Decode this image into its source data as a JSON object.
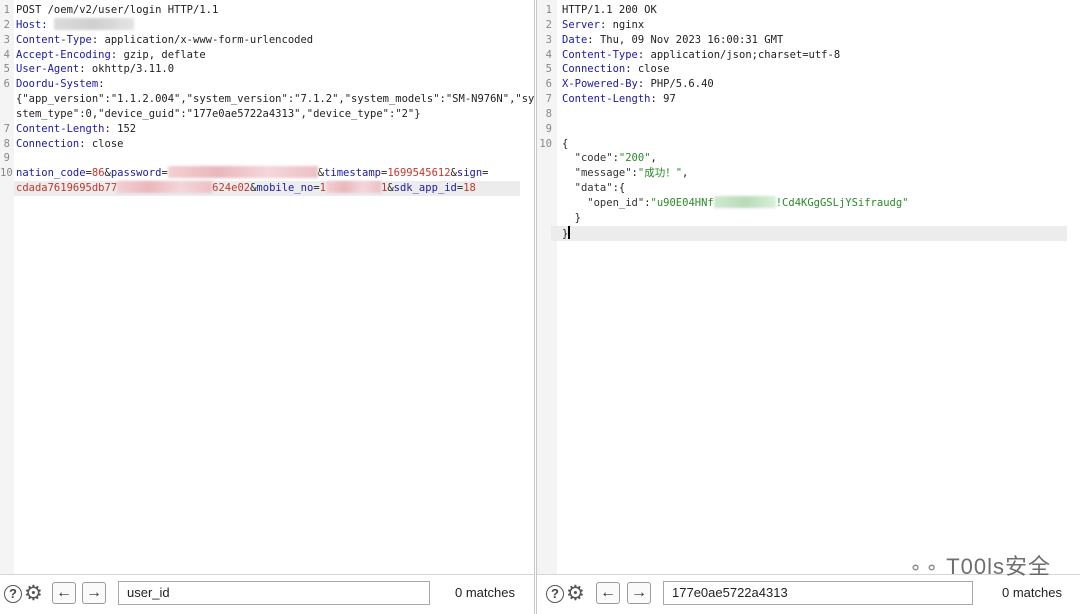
{
  "request": {
    "lines": [
      {
        "num": "1",
        "parts": [
          {
            "t": "POST /oem/v2/user/login HTTP/1.1",
            "c": ""
          }
        ]
      },
      {
        "num": "2",
        "parts": [
          {
            "t": "Host: ",
            "c": "hk"
          },
          {
            "blur": 80,
            "c": "gray"
          }
        ]
      },
      {
        "num": "3",
        "parts": [
          {
            "t": "Content-Type",
            "c": "hk"
          },
          {
            "t": ": application/x-www-form-urlencoded",
            "c": ""
          }
        ]
      },
      {
        "num": "4",
        "parts": [
          {
            "t": "Accept-Encoding",
            "c": "hk"
          },
          {
            "t": ": gzip, deflate",
            "c": ""
          }
        ]
      },
      {
        "num": "5",
        "parts": [
          {
            "t": "User-Agent",
            "c": "hk"
          },
          {
            "t": ": okhttp/3.11.0",
            "c": ""
          }
        ]
      },
      {
        "num": "6",
        "parts": [
          {
            "t": "Doordu-System",
            "c": "hk"
          },
          {
            "t": ":",
            "c": ""
          }
        ]
      },
      {
        "num": "",
        "parts": [
          {
            "t": "{\"app_version\":\"1.1.2.004\",\"system_version\":\"7.1.2\",\"system_models\":\"SM-N976N\",\"sy",
            "c": ""
          }
        ]
      },
      {
        "num": "",
        "parts": [
          {
            "t": "stem_type\":0,\"device_guid\":\"177e0ae5722a4313\",\"device_type\":\"2\"}",
            "c": ""
          }
        ]
      },
      {
        "num": "7",
        "parts": [
          {
            "t": "Content-Length",
            "c": "hk"
          },
          {
            "t": ": 152",
            "c": ""
          }
        ]
      },
      {
        "num": "8",
        "parts": [
          {
            "t": "Connection",
            "c": "hk"
          },
          {
            "t": ": close",
            "c": ""
          }
        ]
      },
      {
        "num": "9",
        "parts": [
          {
            "t": "",
            "c": ""
          }
        ]
      },
      {
        "num": "10",
        "parts": [
          {
            "t": "nation_code",
            "c": "pk"
          },
          {
            "t": "=",
            "c": "amp"
          },
          {
            "t": "86",
            "c": "pv"
          },
          {
            "t": "&",
            "c": "amp"
          },
          {
            "t": "password",
            "c": "pk"
          },
          {
            "t": "=",
            "c": "amp"
          },
          {
            "blur": 150,
            "c": ""
          },
          {
            "t": "&",
            "c": "amp"
          },
          {
            "t": "timestamp",
            "c": "pk"
          },
          {
            "t": "=",
            "c": "amp"
          },
          {
            "t": "1699545612",
            "c": "pv"
          },
          {
            "t": "&",
            "c": "amp"
          },
          {
            "t": "sign",
            "c": "pk"
          },
          {
            "t": "=",
            "c": "amp"
          }
        ]
      },
      {
        "num": "",
        "hl": true,
        "parts": [
          {
            "t": "cdada7619695db77",
            "c": "pv"
          },
          {
            "blur": 95,
            "c": ""
          },
          {
            "t": "624e02",
            "c": "pv"
          },
          {
            "t": "&",
            "c": "amp"
          },
          {
            "t": "mobile_no",
            "c": "pk"
          },
          {
            "t": "=",
            "c": "amp"
          },
          {
            "t": "1",
            "c": "pv"
          },
          {
            "blur": 55,
            "c": ""
          },
          {
            "t": "1",
            "c": "pv"
          },
          {
            "t": "&",
            "c": "amp"
          },
          {
            "t": "sdk_app_id",
            "c": "pk"
          },
          {
            "t": "=",
            "c": "amp"
          },
          {
            "t": "18",
            "c": "pv"
          }
        ]
      }
    ],
    "search_value": "user_id",
    "matches": "0 matches"
  },
  "response": {
    "lines": [
      {
        "num": "1",
        "parts": [
          {
            "t": "HTTP/1.1 200 OK",
            "c": ""
          }
        ]
      },
      {
        "num": "2",
        "parts": [
          {
            "t": "Server",
            "c": "hk"
          },
          {
            "t": ": nginx",
            "c": ""
          }
        ]
      },
      {
        "num": "3",
        "parts": [
          {
            "t": "Date",
            "c": "hk"
          },
          {
            "t": ": Thu, 09 Nov 2023 16:00:31 GMT",
            "c": ""
          }
        ]
      },
      {
        "num": "4",
        "parts": [
          {
            "t": "Content-Type",
            "c": "hk"
          },
          {
            "t": ": application/json;charset=utf-8",
            "c": ""
          }
        ]
      },
      {
        "num": "5",
        "parts": [
          {
            "t": "Connection",
            "c": "hk"
          },
          {
            "t": ": close",
            "c": ""
          }
        ]
      },
      {
        "num": "6",
        "parts": [
          {
            "t": "X-Powered-By",
            "c": "hk"
          },
          {
            "t": ": PHP/5.6.40",
            "c": ""
          }
        ]
      },
      {
        "num": "7",
        "parts": [
          {
            "t": "Content-Length",
            "c": "hk"
          },
          {
            "t": ": 97",
            "c": ""
          }
        ]
      },
      {
        "num": "8",
        "parts": [
          {
            "t": "",
            "c": ""
          }
        ]
      },
      {
        "num": "9",
        "parts": [
          {
            "t": "",
            "c": ""
          }
        ]
      },
      {
        "num": "10",
        "parts": [
          {
            "t": "{",
            "c": ""
          }
        ]
      },
      {
        "num": "",
        "parts": [
          {
            "t": "  \"code\"",
            "c": "jk"
          },
          {
            "t": ":",
            "c": ""
          },
          {
            "t": "\"200\"",
            "c": "js"
          },
          {
            "t": ",",
            "c": ""
          }
        ]
      },
      {
        "num": "",
        "parts": [
          {
            "t": "  \"message\"",
            "c": "jk"
          },
          {
            "t": ":",
            "c": ""
          },
          {
            "t": "\"成功！\"",
            "c": "js"
          },
          {
            "t": ",",
            "c": ""
          }
        ]
      },
      {
        "num": "",
        "parts": [
          {
            "t": "  \"data\"",
            "c": "jk"
          },
          {
            "t": ":{",
            "c": ""
          }
        ]
      },
      {
        "num": "",
        "parts": [
          {
            "t": "    \"open_id\"",
            "c": "jk"
          },
          {
            "t": ":",
            "c": ""
          },
          {
            "t": "\"u90E04HNf",
            "c": "js"
          },
          {
            "blur": 62,
            "c": "green"
          },
          {
            "t": "!Cd4KGgGSLjYSifraudg\"",
            "c": "js"
          }
        ]
      },
      {
        "num": "",
        "parts": [
          {
            "t": "  }",
            "c": ""
          }
        ]
      },
      {
        "num": "",
        "hl": true,
        "caret": true,
        "parts": [
          {
            "t": "}",
            "c": ""
          }
        ]
      }
    ],
    "search_value": "177e0ae5722a4313",
    "matches": "0 matches"
  },
  "watermark": "T00ls安全",
  "icons": {
    "help": "help-icon",
    "settings": "gear-icon",
    "back": "arrow-left-icon",
    "forward": "arrow-right-icon"
  }
}
